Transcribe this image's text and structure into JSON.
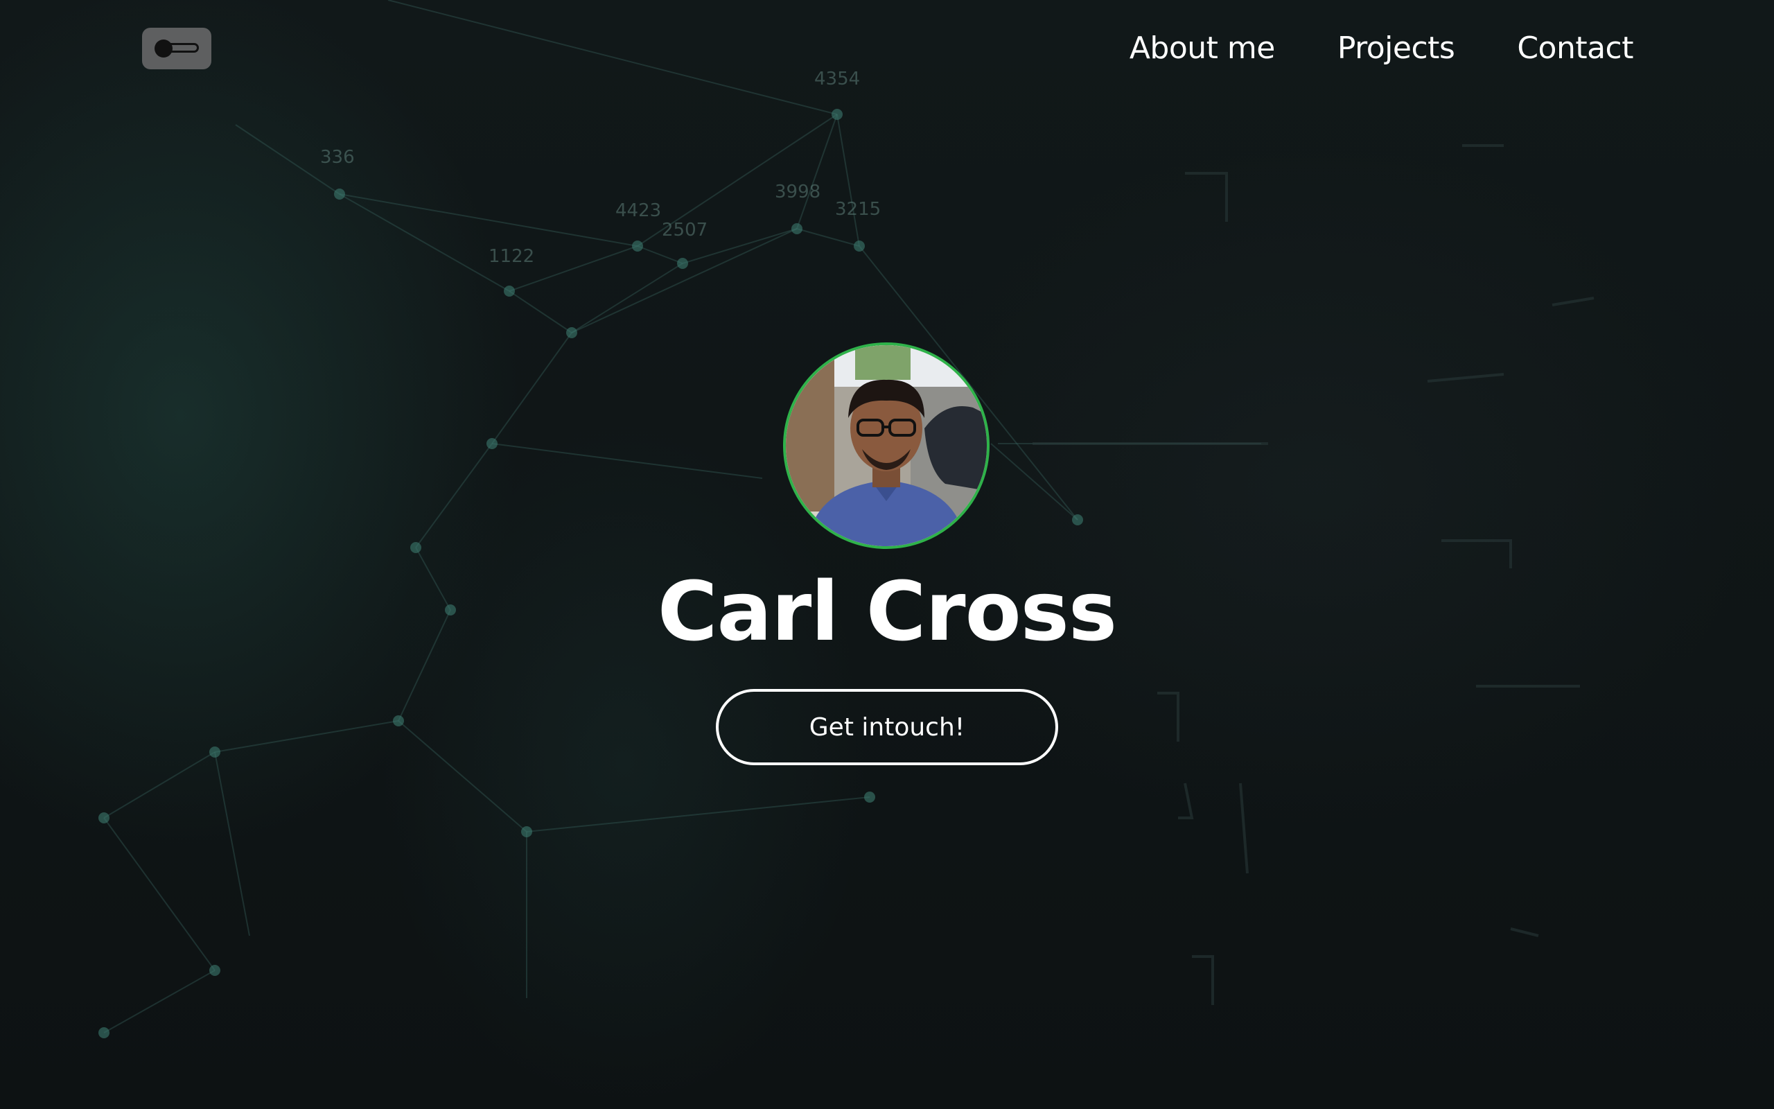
{
  "header": {
    "theme_toggle_icon": "toggle-switch-icon",
    "nav": [
      {
        "label": "About me"
      },
      {
        "label": "Projects"
      },
      {
        "label": "Contact"
      }
    ]
  },
  "hero": {
    "name": "Carl Cross",
    "cta_label": "Get intouch!",
    "avatar_alt": "profile photo"
  },
  "colors": {
    "background": "#0f1415",
    "accent_ring": "#2fb24a",
    "text": "#ffffff",
    "toggle_bg": "#5e5f60"
  },
  "background_numbers": [
    "4354",
    "336",
    "3998",
    "3215",
    "4423",
    "2507",
    "1122"
  ]
}
